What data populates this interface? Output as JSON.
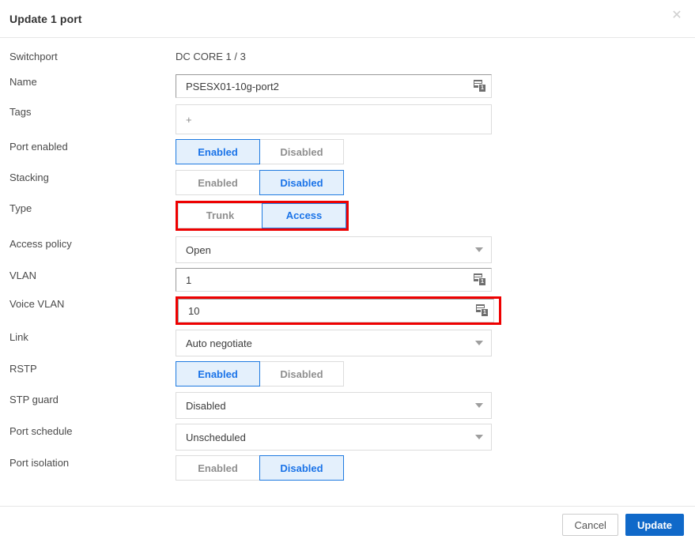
{
  "dialog": {
    "title": "Update 1 port",
    "close_icon": "close-icon"
  },
  "fields": {
    "switchport": {
      "label": "Switchport",
      "value": "DC CORE 1 / 3"
    },
    "name": {
      "label": "Name",
      "value": "PSESX01-10g-port2",
      "badge": "1"
    },
    "tags": {
      "label": "Tags",
      "add_glyph": "+"
    },
    "port_enabled": {
      "label": "Port enabled",
      "options": [
        "Enabled",
        "Disabled"
      ],
      "selected": "Enabled"
    },
    "stacking": {
      "label": "Stacking",
      "options": [
        "Enabled",
        "Disabled"
      ],
      "selected": "Disabled"
    },
    "type": {
      "label": "Type",
      "options": [
        "Trunk",
        "Access"
      ],
      "selected": "Access",
      "highlighted": true
    },
    "access_policy": {
      "label": "Access policy",
      "value": "Open"
    },
    "vlan": {
      "label": "VLAN",
      "value": "1",
      "badge": "1"
    },
    "voice_vlan": {
      "label": "Voice VLAN",
      "value": "10",
      "badge": "1",
      "highlighted": true
    },
    "link": {
      "label": "Link",
      "value": "Auto negotiate"
    },
    "rstp": {
      "label": "RSTP",
      "options": [
        "Enabled",
        "Disabled"
      ],
      "selected": "Enabled"
    },
    "stp_guard": {
      "label": "STP guard",
      "value": "Disabled"
    },
    "port_schedule": {
      "label": "Port schedule",
      "value": "Unscheduled"
    },
    "port_isolation": {
      "label": "Port isolation",
      "options": [
        "Enabled",
        "Disabled"
      ],
      "selected": "Disabled"
    }
  },
  "footer": {
    "cancel_label": "Cancel",
    "update_label": "Update"
  },
  "colors": {
    "accent": "#1a73e8",
    "primary_button": "#1069c9",
    "toggle_active_bg": "#e4f0fc",
    "annotation_red": "#ee0000"
  }
}
